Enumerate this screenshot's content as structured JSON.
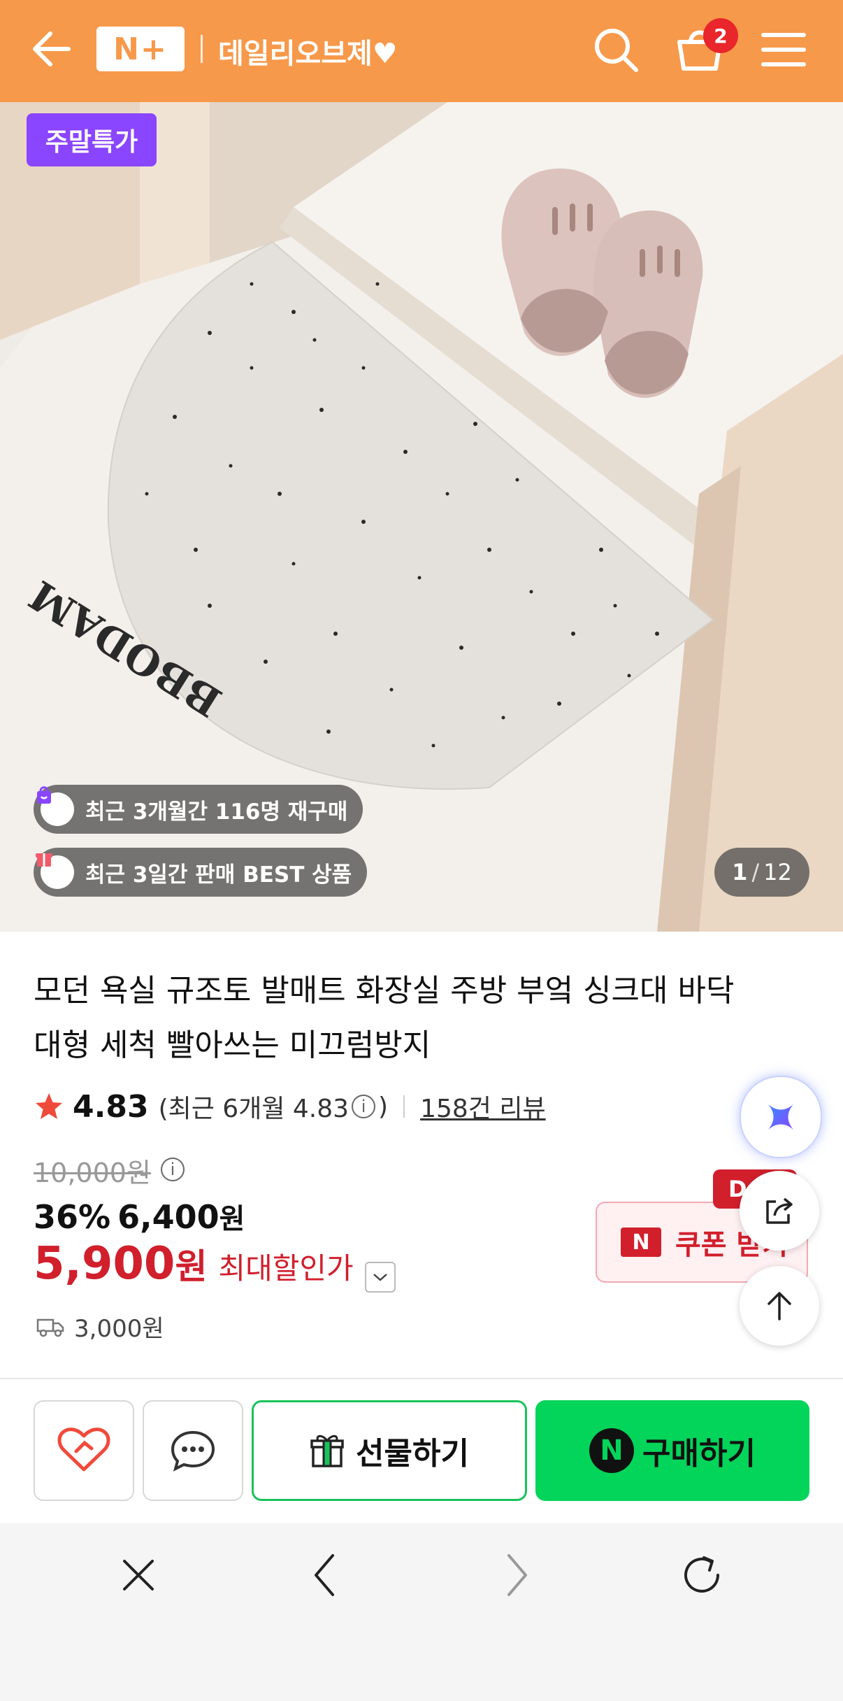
{
  "header": {
    "logo_text": "N+",
    "store_name": "데일리오브제♥",
    "cart_count": "2",
    "icons": [
      "back-arrow-icon",
      "search-icon",
      "cart-icon",
      "menu-icon"
    ],
    "bg_color": "#f7994a"
  },
  "hero": {
    "promo_tag": "주말특가",
    "mat_text": "BBODAM",
    "badges": [
      {
        "text": "최근 3개월간 116명 재구매",
        "icon": "repurchase-bag-icon",
        "icon_color": "#8a45ff"
      },
      {
        "text": "최근 3일간 판매 BEST 상품",
        "icon": "gift-box-icon",
        "icon_color": "#f25a6a"
      }
    ],
    "counter_current": "1",
    "counter_separator": "/",
    "counter_total": "12"
  },
  "product": {
    "title_line1": "모던 욕실 규조토 발매트 화장실 주방 부엌 싱크대 바닥",
    "title_line2": "대형 세척 빨아쓰는 미끄럼방지",
    "rating": "4.83",
    "recent_rating_open": "(최근 6개월 4.83",
    "recent_rating_close": ")",
    "review_link": "158건 리뷰",
    "original_price": "10,000원",
    "discount_percent": "36%",
    "discount_price": "6,400",
    "won": "원",
    "final_price": "5,900",
    "max_discount_label": "최대할인가",
    "shipping_fee": "3,000원",
    "price_color": "#d11f2c"
  },
  "coupon": {
    "logo": "N",
    "label": "쿠폰 받기",
    "badge": "D"
  },
  "actions": {
    "gift_label": "선물하기",
    "buy_logo": "N",
    "buy_label": "구매하기",
    "buy_color": "#03d45a"
  }
}
